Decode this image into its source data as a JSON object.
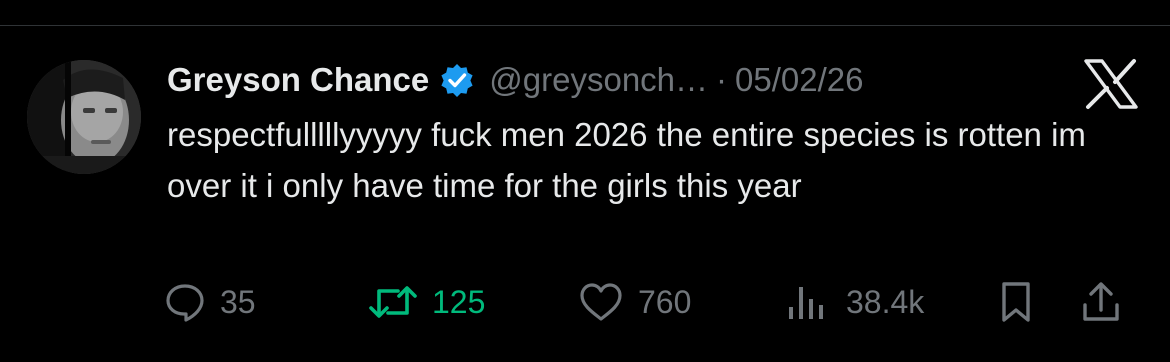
{
  "colors": {
    "background": "#000000",
    "text_primary": "#e7e9ea",
    "text_secondary": "#71767b",
    "verified_blue": "#1d9bf0",
    "retweet_green": "#00ba7c"
  },
  "post": {
    "author": {
      "display_name": "Greyson Chance",
      "handle": "@greysonch…",
      "verified": true,
      "avatar_icon": "profile-photo"
    },
    "separator": "·",
    "date": "05/02/26",
    "brand_icon": "x-logo-icon",
    "text": "respectfulllllyyyyy fuck men 2026 the entire species is rotten im over it i only have time for the girls this year",
    "actions": {
      "replies": {
        "icon": "reply-icon",
        "count": "35"
      },
      "reposts": {
        "icon": "repost-icon",
        "count": "125",
        "active": true
      },
      "likes": {
        "icon": "heart-icon",
        "count": "760"
      },
      "views": {
        "icon": "views-icon",
        "count": "38.4k"
      },
      "bookmark": {
        "icon": "bookmark-icon"
      },
      "share": {
        "icon": "share-icon"
      }
    }
  }
}
